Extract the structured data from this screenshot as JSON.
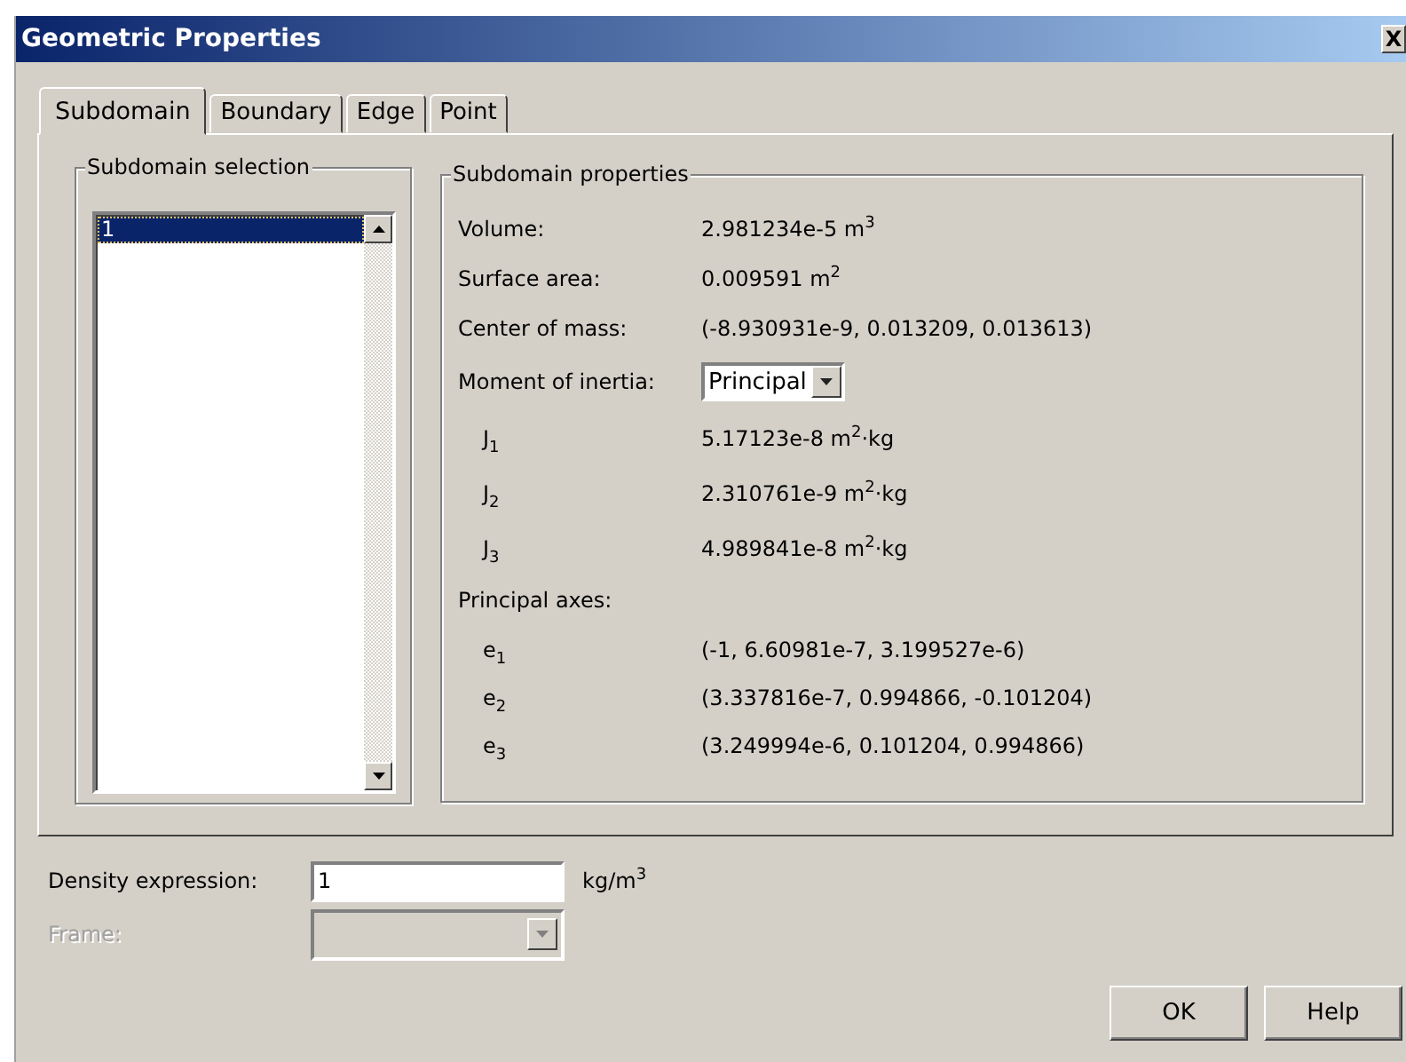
{
  "window": {
    "title": "Geometric Properties",
    "close": "X"
  },
  "tabs": [
    {
      "label": "Subdomain",
      "selected": true
    },
    {
      "label": "Boundary",
      "selected": false
    },
    {
      "label": "Edge",
      "selected": false
    },
    {
      "label": "Point",
      "selected": false
    }
  ],
  "selection_group": {
    "title": "Subdomain selection",
    "items": [
      {
        "label": "1",
        "selected": true
      }
    ]
  },
  "properties_group": {
    "title": "Subdomain properties",
    "rows": [
      {
        "kind": "value",
        "label": "Volume:",
        "value": "2.981234e-5 m$^{3}$"
      },
      {
        "kind": "value",
        "label": "Surface area:",
        "value": "0.009591 m$^{2}$"
      },
      {
        "kind": "value",
        "label": "Center of mass:",
        "value": "(-8.930931e-9, 0.013209, 0.013613)"
      },
      {
        "kind": "select",
        "label": "Moment of inertia:",
        "value": "Principal"
      },
      {
        "kind": "sub",
        "label": "J$_{1}$",
        "value": "5.17123e-8 m$^{2}$·kg"
      },
      {
        "kind": "sub",
        "label": "J$_{2}$",
        "value": "2.310761e-9 m$^{2}$·kg"
      },
      {
        "kind": "sub",
        "label": "J$_{3}$",
        "value": "4.989841e-8 m$^{2}$·kg"
      },
      {
        "kind": "heading",
        "label": "Principal axes:"
      },
      {
        "kind": "sub",
        "label": "e$_{1}$",
        "value": "(-1, 6.60981e-7, 3.199527e-6)"
      },
      {
        "kind": "sub",
        "label": "e$_{2}$",
        "value": "(3.337816e-7, 0.994866, -0.101204)"
      },
      {
        "kind": "sub",
        "label": "e$_{3}$",
        "value": "(3.249994e-6, 0.101204, 0.994866)"
      }
    ]
  },
  "density": {
    "label": "Density expression:",
    "value": "1",
    "unit": "kg/m$^{3}$"
  },
  "frame": {
    "label": "Frame:",
    "disabled": true
  },
  "buttons": [
    "OK",
    "Help"
  ]
}
